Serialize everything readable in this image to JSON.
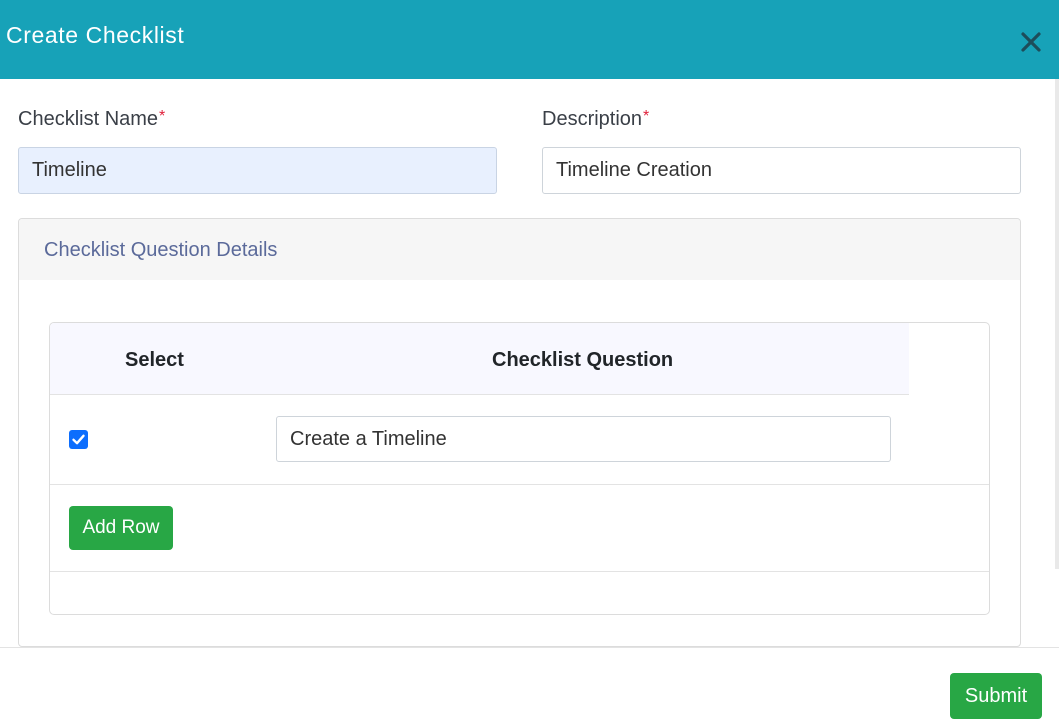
{
  "modal": {
    "title": "Create Checklist",
    "close_icon": "close-icon"
  },
  "form": {
    "checklist_name": {
      "label": "Checklist Name",
      "required_marker": "*",
      "value": "Timeline"
    },
    "description": {
      "label": "Description",
      "required_marker": "*",
      "value": "Timeline Creation"
    }
  },
  "question_details": {
    "title": "Checklist Question Details",
    "columns": [
      "Select",
      "Checklist Question"
    ],
    "rows": [
      {
        "selected": true,
        "question": "Create a Timeline"
      }
    ],
    "add_row_label": "Add Row"
  },
  "footer": {
    "submit_label": "Submit"
  },
  "colors": {
    "header_bg": "#17a2b8",
    "button_green": "#28a745",
    "checkbox_blue": "#0d6efd",
    "required_red": "#e0203a",
    "section_title": "#5b6a9a"
  }
}
